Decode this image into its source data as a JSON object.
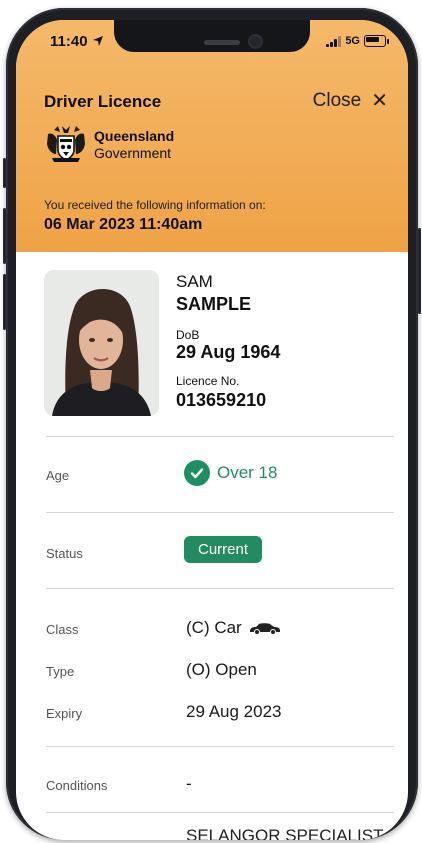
{
  "status_bar": {
    "time": "11:40",
    "network": "5G"
  },
  "header": {
    "title": "Driver Licence",
    "close_label": "Close",
    "logo_line1": "Queensland",
    "logo_line2": "Government",
    "received_label": "You received the following information on:",
    "received_date": "06 Mar 2023 11:40am"
  },
  "person": {
    "given_name": "SAM",
    "family_name": "SAMPLE",
    "dob_label": "DoB",
    "dob": "29 Aug 1964",
    "licence_label": "Licence No.",
    "licence_number": "013659210"
  },
  "rows": {
    "age_label": "Age",
    "age_value": "Over 18",
    "status_label": "Status",
    "status_value": "Current",
    "class_label": "Class",
    "class_value": "(C) Car",
    "type_label": "Type",
    "type_value": "(O) Open",
    "expiry_label": "Expiry",
    "expiry_value": "29 Aug 2023",
    "conditions_label": "Conditions",
    "conditions_value": "-",
    "next_value_partial": "SELANGOR SPECIALIST"
  },
  "colors": {
    "header_orange": "#f2ad57",
    "accent_green": "#1f8f62",
    "status_green": "#238a62"
  },
  "icons": [
    "location-arrow-icon",
    "signal-bars-icon",
    "battery-icon",
    "close-icon",
    "queensland-crest-logo",
    "check-circle-icon",
    "car-icon"
  ]
}
